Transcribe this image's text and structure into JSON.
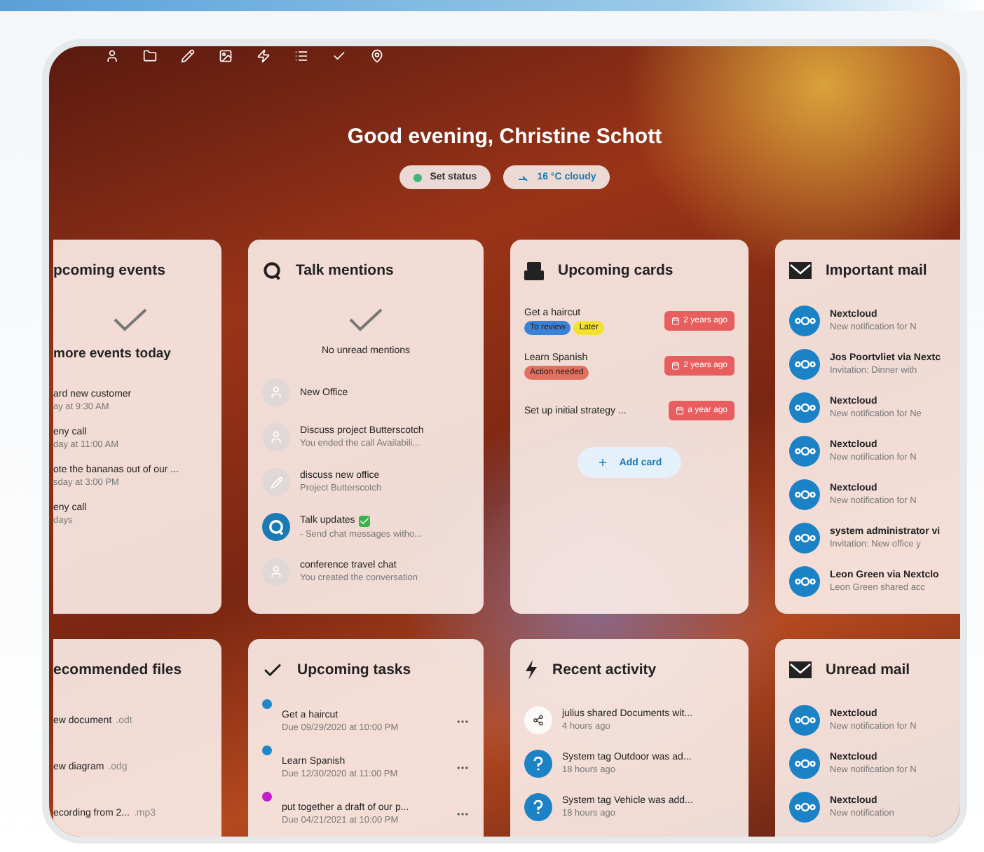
{
  "greeting": "Good evening, Christine Schott",
  "status_buttons": [
    {
      "kind": "status",
      "label": "Set status"
    },
    {
      "kind": "weather",
      "label": "16 °C cloudy"
    }
  ],
  "widgets_top": [
    {
      "kind": "events",
      "title": "pcoming events",
      "subtitle": "more events today",
      "items": [
        {
          "title": "ard new customer",
          "sub": "ay at 9:30 AM"
        },
        {
          "title": "eny call",
          "sub": "day at 11:00 AM"
        },
        {
          "title": "ote the bananas out of our ...",
          "sub": "sday at 3:00 PM"
        },
        {
          "title": "eny call",
          "sub": "days"
        }
      ]
    },
    {
      "kind": "talk",
      "title": "Talk mentions",
      "subtitle": "No unread mentions",
      "items": [
        {
          "kind": "person",
          "title": "New Office"
        },
        {
          "kind": "person",
          "title": "Discuss project Butterscotch",
          "sub": "You ended the call Availabili..."
        },
        {
          "kind": "pencil",
          "title": "discuss new office",
          "sub": "Project Butterscotch"
        },
        {
          "kind": "talk",
          "title": "Talk updates",
          "verified": true,
          "sub": "- Send chat messages witho..."
        },
        {
          "kind": "person",
          "title": "conference travel chat",
          "sub": "You created the conversation"
        }
      ]
    },
    {
      "kind": "deck",
      "title": "Upcoming cards",
      "items": [
        {
          "title": "Get a haircut",
          "due": "2 years ago",
          "labels": [
            {
              "text": "To review",
              "color": "#3b82d6"
            },
            {
              "text": "Later",
              "color": "#f2e22c"
            }
          ]
        },
        {
          "title": "Learn Spanish",
          "due": "2 years ago",
          "labels": [
            {
              "text": "Action needed",
              "color": "#e3705f"
            }
          ]
        },
        {
          "title": "Set up initial strategy ...",
          "due": "a year ago"
        }
      ],
      "button": "Add card"
    },
    {
      "kind": "mail",
      "title": "Important mail",
      "items": [
        {
          "title": "Nextcloud",
          "sub": "New notification for N"
        },
        {
          "title": "Jos Poortvliet via Nextc",
          "sub": "Invitation: Dinner with"
        },
        {
          "title": "Nextcloud",
          "sub": "New notification for Ne"
        },
        {
          "title": "Nextcloud",
          "sub": "New notification for N"
        },
        {
          "title": "Nextcloud",
          "sub": "New notification for N"
        },
        {
          "title": "system administrator vi",
          "sub": "Invitation: New office y"
        },
        {
          "title": "Leon Green via Nextclo",
          "sub": "Leon Green shared acc"
        }
      ]
    }
  ],
  "widgets_bottom": [
    {
      "kind": "files",
      "title": "ecommended files",
      "items": [
        {
          "title": "ew document",
          "ext": ".odt"
        },
        {
          "title": "ew diagram",
          "ext": ".odg"
        },
        {
          "title": "ecording from 2...",
          "ext": ".mp3"
        }
      ]
    },
    {
      "kind": "tasks",
      "title": "Upcoming tasks",
      "items": [
        {
          "title": "Get a haircut",
          "sub": "Due 09/29/2020 at 10:00 PM",
          "color": "#1e88c7"
        },
        {
          "title": "Learn Spanish",
          "sub": "Due 12/30/2020 at 11:00 PM",
          "color": "#1e88c7"
        },
        {
          "title": "put together a draft of our p...",
          "sub": "Due 04/21/2021 at 10:00 PM",
          "color": "#c21fc9"
        }
      ]
    },
    {
      "kind": "activity",
      "title": "Recent activity",
      "items": [
        {
          "kind": "share",
          "title": "julius shared Documents wit...",
          "sub": "4 hours ago"
        },
        {
          "kind": "tag",
          "title": "System tag Outdoor was ad...",
          "sub": "18 hours ago"
        },
        {
          "kind": "tag",
          "title": "System tag Vehicle was add...",
          "sub": "18 hours ago"
        }
      ]
    },
    {
      "kind": "mail",
      "title": "Unread mail",
      "items": [
        {
          "title": "Nextcloud",
          "sub": "New notification for N"
        },
        {
          "title": "Nextcloud",
          "sub": "New notification for N"
        },
        {
          "title": "Nextcloud",
          "sub": "New notification"
        }
      ]
    }
  ]
}
